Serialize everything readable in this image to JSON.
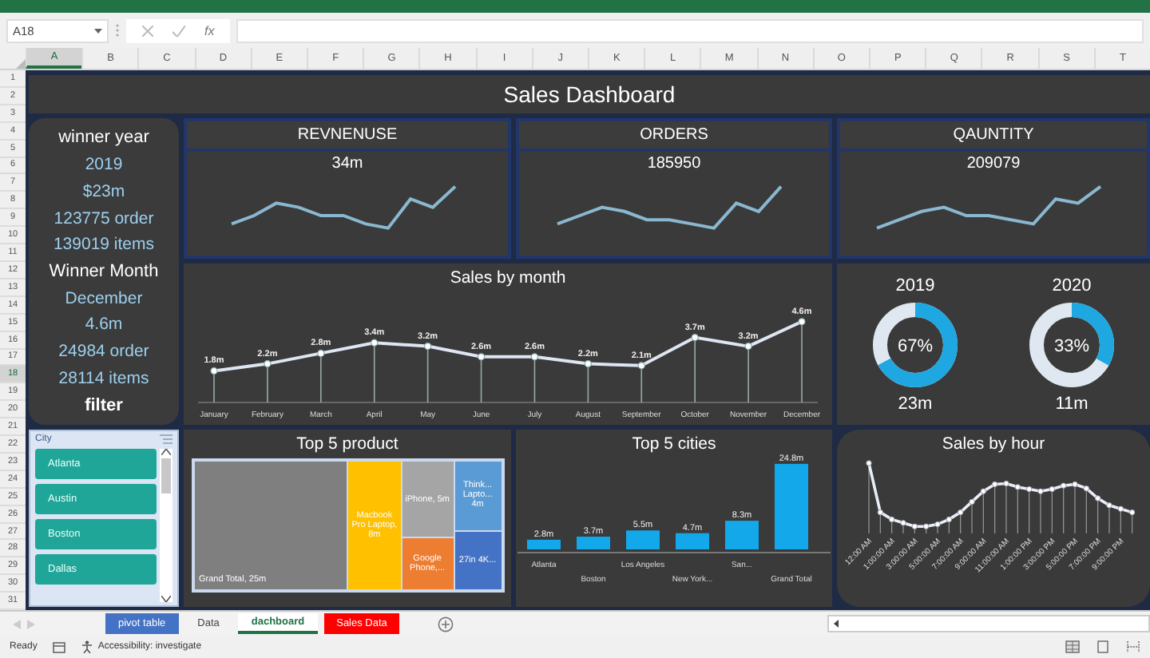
{
  "formula_bar": {
    "name_box": "A18",
    "function_label": "fx"
  },
  "columns": [
    {
      "label": "A",
      "selected": true
    },
    {
      "label": "B",
      "selected": false
    },
    {
      "label": "C",
      "selected": false
    },
    {
      "label": "D",
      "selected": false
    },
    {
      "label": "E",
      "selected": false
    },
    {
      "label": "F",
      "selected": false
    },
    {
      "label": "G",
      "selected": false
    },
    {
      "label": "H",
      "selected": false
    },
    {
      "label": "I",
      "selected": false
    },
    {
      "label": "J",
      "selected": false
    },
    {
      "label": "K",
      "selected": false
    },
    {
      "label": "L",
      "selected": false
    },
    {
      "label": "M",
      "selected": false
    },
    {
      "label": "N",
      "selected": false
    },
    {
      "label": "O",
      "selected": false
    },
    {
      "label": "P",
      "selected": false
    },
    {
      "label": "Q",
      "selected": false
    },
    {
      "label": "R",
      "selected": false
    },
    {
      "label": "S",
      "selected": false
    },
    {
      "label": "T",
      "selected": false
    }
  ],
  "rows": [
    {
      "label": "1",
      "selected": false
    },
    {
      "label": "2",
      "selected": false
    },
    {
      "label": "3",
      "selected": false
    },
    {
      "label": "4",
      "selected": false
    },
    {
      "label": "5",
      "selected": false
    },
    {
      "label": "6",
      "selected": false
    },
    {
      "label": "7",
      "selected": false
    },
    {
      "label": "8",
      "selected": false
    },
    {
      "label": "9",
      "selected": false
    },
    {
      "label": "10",
      "selected": false
    },
    {
      "label": "11",
      "selected": false
    },
    {
      "label": "12",
      "selected": false
    },
    {
      "label": "13",
      "selected": false
    },
    {
      "label": "14",
      "selected": false
    },
    {
      "label": "15",
      "selected": false
    },
    {
      "label": "16",
      "selected": false
    },
    {
      "label": "17",
      "selected": false
    },
    {
      "label": "18",
      "selected": true
    },
    {
      "label": "19",
      "selected": false
    },
    {
      "label": "20",
      "selected": false
    },
    {
      "label": "21",
      "selected": false
    },
    {
      "label": "22",
      "selected": false
    },
    {
      "label": "23",
      "selected": false
    },
    {
      "label": "24",
      "selected": false
    },
    {
      "label": "25",
      "selected": false
    },
    {
      "label": "26",
      "selected": false
    },
    {
      "label": "27",
      "selected": false
    },
    {
      "label": "28",
      "selected": false
    },
    {
      "label": "29",
      "selected": false
    },
    {
      "label": "30",
      "selected": false
    },
    {
      "label": "31",
      "selected": false
    }
  ],
  "dashboard": {
    "title": "Sales Dashboard",
    "summary": {
      "sections": [
        {
          "heading": "winner year",
          "lines": [
            "2019",
            "$23m",
            "123775 order",
            "139019 items"
          ]
        },
        {
          "heading": "Winner Month",
          "lines": [
            "December",
            "4.6m",
            "24984 order",
            "28114 items"
          ]
        }
      ],
      "filter_heading": "filter"
    },
    "slicer": {
      "title": "City",
      "items": [
        {
          "label": "Atlanta",
          "selected": true
        },
        {
          "label": "Austin",
          "selected": true
        },
        {
          "label": "Boston",
          "selected": true
        },
        {
          "label": "Dallas",
          "selected": true
        }
      ]
    },
    "kpis": [
      {
        "title": "REVNENUSE",
        "value": "34m"
      },
      {
        "title": "ORDERS",
        "value": "185950"
      },
      {
        "title": "QAUNTITY",
        "value": "209079"
      }
    ],
    "sales_by_month": {
      "chart_data": {
        "type": "line",
        "title": "Sales by month",
        "categories": [
          "January",
          "February",
          "March",
          "April",
          "May",
          "June",
          "July",
          "August",
          "September",
          "October",
          "November",
          "December"
        ],
        "values": [
          1.8,
          2.2,
          2.8,
          3.4,
          3.2,
          2.6,
          2.6,
          2.2,
          2.1,
          3.7,
          3.2,
          4.6
        ],
        "grid": true,
        "marker": true,
        "value_labels": [
          "1.8m",
          "2.2m",
          "2.8m",
          "3.4m",
          "3.2m",
          "2.6m",
          "2.6m",
          "2.2m",
          "2.1m",
          "3.7m",
          "3.2m",
          "4.6m"
        ]
      }
    },
    "donuts": [
      {
        "year": "2019",
        "level": 0.67,
        "reading": "67%",
        "total": "23m"
      },
      {
        "year": "2020",
        "level": 0.33,
        "reading": "33%",
        "total": "11m"
      }
    ],
    "top_products": {
      "title": "Top 5 product",
      "tiles": [
        {
          "label": "Grand Total, 25m",
          "color": "#7f7f7f"
        },
        {
          "label": "Macbook Pro Laptop, 8m",
          "color": "#ffc000"
        },
        {
          "label": "iPhone, 5m",
          "color": "#a5a5a5"
        },
        {
          "label": "Think... Lapto... 4m",
          "color": "#5b9bd5"
        },
        {
          "label": "Google Phone,...",
          "color": "#ed7d31"
        },
        {
          "label": "27in 4K...",
          "color": "#4472c4"
        }
      ]
    },
    "top_cities": {
      "chart_data": {
        "type": "bar",
        "title": "Top 5 cities",
        "categories": [
          "Atlanta",
          "Boston",
          "Los Angeles",
          "New York...",
          "San...",
          "Grand Total"
        ],
        "values": [
          2.8,
          3.7,
          5.5,
          4.7,
          8.3,
          24.8
        ],
        "value_labels": [
          "2.8m",
          "3.7m",
          "5.5m",
          "4.7m",
          "8.3m",
          "24.8m"
        ]
      }
    },
    "sales_by_hour": {
      "title": "Sales by hour",
      "x_labels": [
        "12:00 AM",
        "1:00:00 AM",
        "3:00:00 AM",
        "5:00:00 AM",
        "7:00:00 AM",
        "9:00:00 AM",
        "11:00:00 AM",
        "1:00:00 PM",
        "3:00:00 PM",
        "5:00:00 PM",
        "7:00:00 PM",
        "9:00:00 PM"
      ]
    }
  },
  "sheet_tabs": [
    {
      "label": "pivot table",
      "selected": false,
      "color": "#4472c4"
    },
    {
      "label": "Data",
      "selected": false
    },
    {
      "label": "dachboard",
      "selected": true
    },
    {
      "label": "Sales Data",
      "selected": false,
      "color": "#ff0000"
    }
  ],
  "status_bar": {
    "mode": "Ready",
    "accessibility": "Accessibility: investigate"
  }
}
